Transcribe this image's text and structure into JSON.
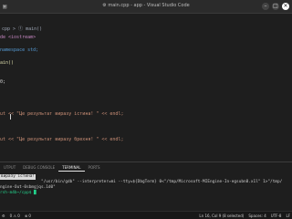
{
  "window": {
    "title": "⚙ main.cpp - app - Visual Studio Code",
    "close_glyph": "✕",
    "min_glyph": "–",
    "max_glyph": "□"
  },
  "breadcrumb": "cpp > ⓕ main()",
  "code_lines": [
    {
      "a": "de <iostream>",
      "cls": "inc"
    },
    {
      "a": "",
      "cls": "txt"
    },
    {
      "a": "namespace std;",
      "cls": "kw"
    },
    {
      "a": "",
      "cls": "txt"
    },
    {
      "a": "ain()",
      "cls": "fn"
    },
    {
      "a": "",
      "cls": "txt"
    },
    {
      "a": "",
      "cls": "txt"
    },
    {
      "a": "0;",
      "cls": "txt"
    },
    {
      "a": "",
      "cls": "txt"
    },
    {
      "a": "",
      "cls": "txt"
    },
    {
      "a": "",
      "cls": "txt"
    },
    {
      "a": "",
      "cls": "txt"
    },
    {
      "a": "ut << \"Це результат виразу істина! \" << endl;",
      "cls": "str"
    },
    {
      "a": "",
      "cls": "txt"
    },
    {
      "a": "",
      "cls": "txt"
    },
    {
      "a": "",
      "cls": "txt"
    },
    {
      "a": "ut << \"Це результат виразу брехня! \" << endl;",
      "cls": "str"
    }
  ],
  "panel_tabs": [
    "UTPUT",
    "DEBUG CONSOLE",
    "TERMINAL",
    "PORTS"
  ],
  "terminal_lines": [
    {
      "text": "виразу істина!",
      "style": "hl"
    },
    {
      "text": "                 \"/usr/bin/gdb\" --interpreter=mi --tty=${DbgTerm} 0<\"/tmp/Microsoft-MIEngine-In-egsubn8.x1l\" 1>\"/tmp/",
      "style": ""
    },
    {
      "text": "ngine-Out-0sbmgjqs.1d0\"",
      "style": ""
    },
    {
      "text": "rsh-m4b~/cpp$ █",
      "style": "green"
    }
  ],
  "status": {
    "left": [
      "⚙",
      "0 ⚠ 0",
      "⊗ 0"
    ],
    "right": [
      "Ln 16, Col 9 (8 selected)",
      "Spaces: 4",
      "UTF-8",
      "LF"
    ]
  }
}
